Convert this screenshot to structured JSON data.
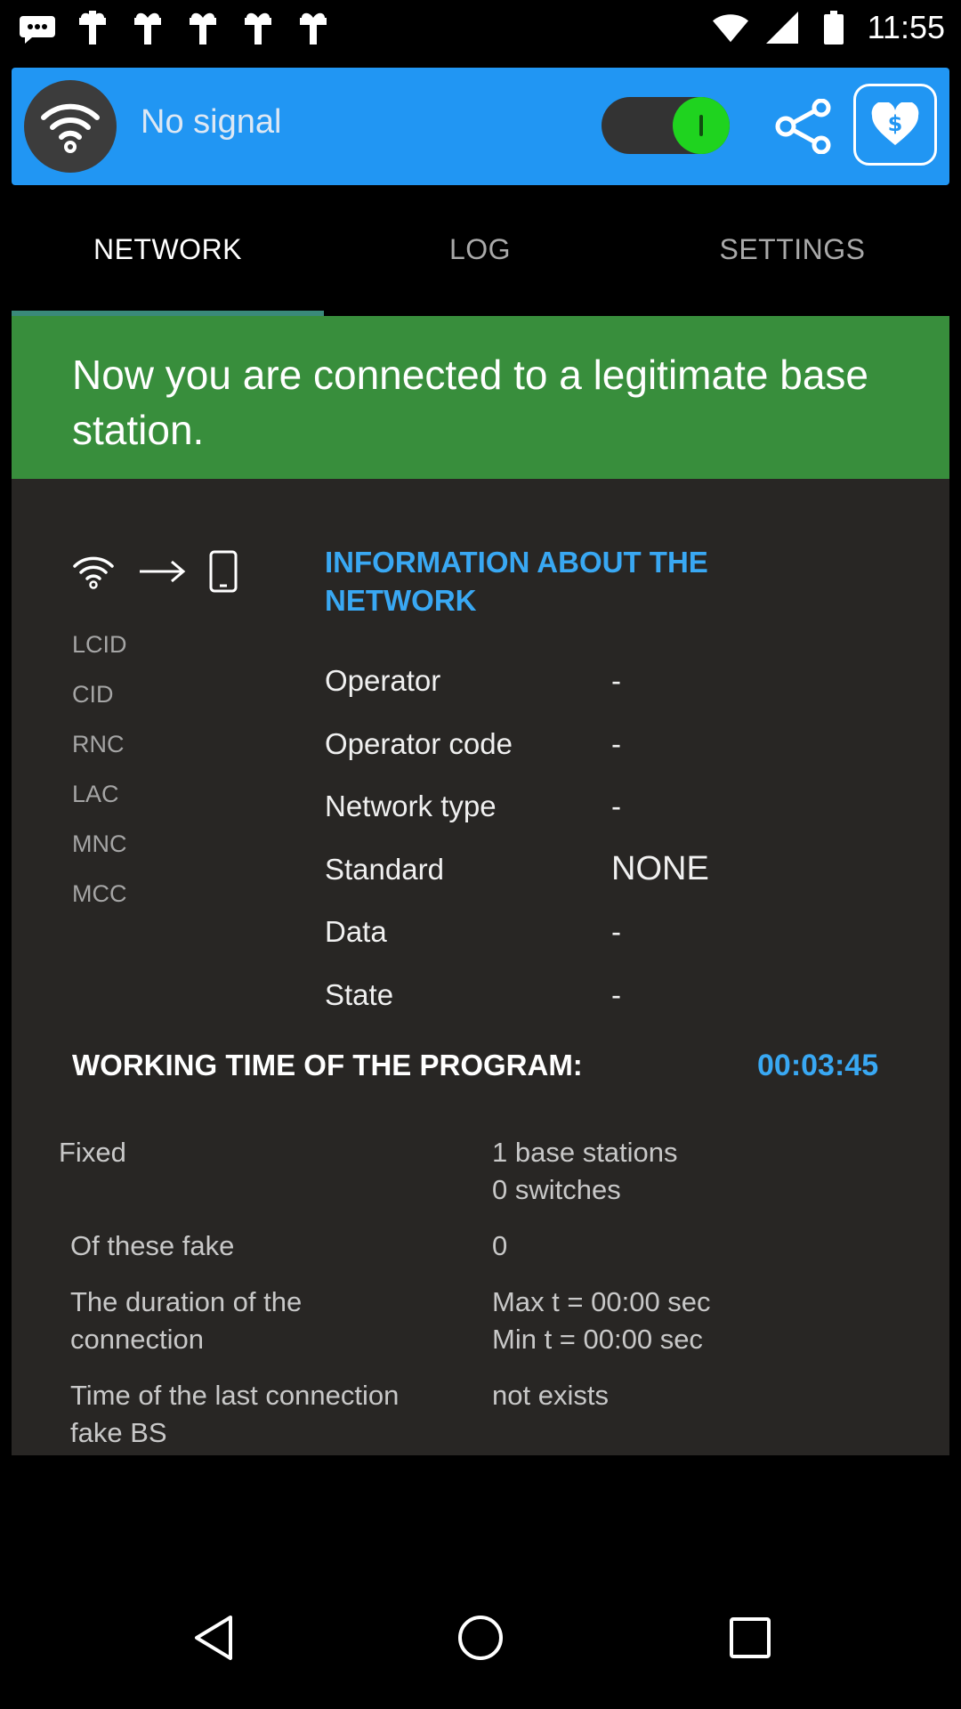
{
  "status_bar": {
    "time": "11:55",
    "icons": [
      "messages-icon",
      "notification-icon",
      "notification-icon",
      "notification-icon",
      "notification-icon",
      "notification-icon",
      "wifi-icon",
      "cellular-signal-icon",
      "battery-icon"
    ]
  },
  "top_bar": {
    "signal_text": "No signal",
    "toggle_on": true,
    "colors": {
      "bar": "#2196f3",
      "toggle_knob": "#1fd31f"
    }
  },
  "tabs": [
    {
      "label": "NETWORK",
      "active": true
    },
    {
      "label": "LOG",
      "active": false
    },
    {
      "label": "SETTINGS",
      "active": false
    }
  ],
  "banner": {
    "text": "Now you are connected to a legitimate base station.",
    "color": "#388e3c"
  },
  "side_labels": [
    "LCID",
    "CID",
    "RNC",
    "LAC",
    "MNC",
    "MCC"
  ],
  "info": {
    "title": "INFORMATION ABOUT THE NETWORK",
    "rows": [
      {
        "key": "Operator",
        "value": "-"
      },
      {
        "key": "Operator code",
        "value": "-"
      },
      {
        "key": "Network type",
        "value": "-"
      },
      {
        "key": "Standard",
        "value": "NONE"
      },
      {
        "key": "Data",
        "value": "-"
      },
      {
        "key": "State",
        "value": "-"
      }
    ]
  },
  "working": {
    "label": "WORKING TIME OF THE PROGRAM:",
    "time": "00:03:45"
  },
  "stats": {
    "fixed_label": "Fixed",
    "fixed_line1": "1 base stations",
    "fixed_line2": "0 switches",
    "fake_label": "Of these fake",
    "fake_value": "0",
    "duration_label_1": "The duration of the",
    "duration_label_2": "connection",
    "duration_max": "Max t = 00:00 sec",
    "duration_min": "Min t = 00:00 sec",
    "last_label_1": "Time of the last connection",
    "last_label_2": "fake BS",
    "last_value": "not exists"
  },
  "nav_bar": [
    "back-icon",
    "home-icon",
    "recents-icon"
  ]
}
